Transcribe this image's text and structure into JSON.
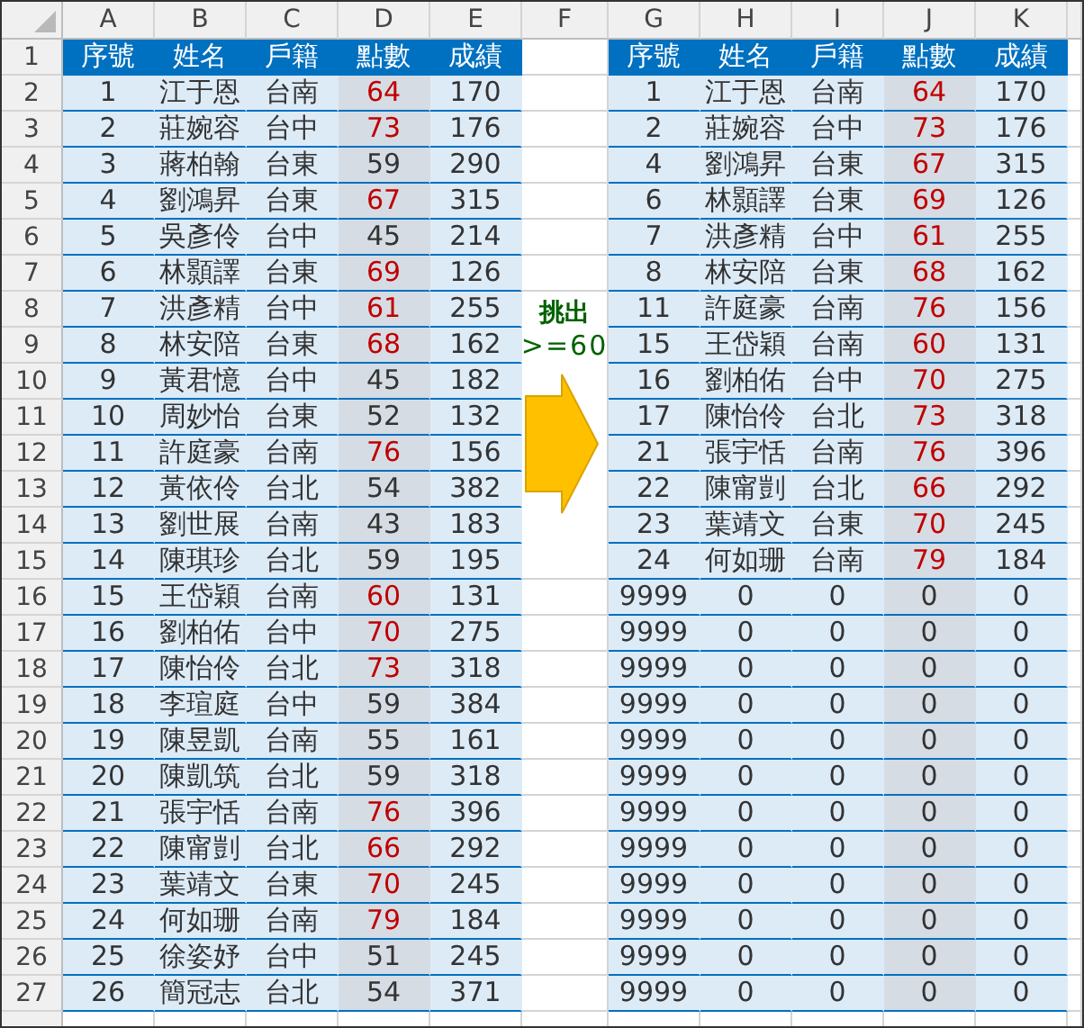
{
  "columns": [
    "A",
    "B",
    "C",
    "D",
    "E",
    "F",
    "G",
    "H",
    "I",
    "J",
    "K"
  ],
  "row_numbers": [
    "1",
    "2",
    "3",
    "4",
    "5",
    "6",
    "7",
    "8",
    "9",
    "10",
    "11",
    "12",
    "13",
    "14",
    "15",
    "16",
    "17",
    "18",
    "19",
    "20",
    "21",
    "22",
    "23",
    "24",
    "25",
    "26",
    "27"
  ],
  "source_table": {
    "headers": [
      "序號",
      "姓名",
      "戶籍",
      "點數",
      "成績"
    ],
    "rows": [
      {
        "no": "1",
        "name": "江于恩",
        "city": "台南",
        "points": "64",
        "score": "170",
        "highlighted": true
      },
      {
        "no": "2",
        "name": "莊婉容",
        "city": "台中",
        "points": "73",
        "score": "176",
        "highlighted": true
      },
      {
        "no": "3",
        "name": "蔣柏翰",
        "city": "台東",
        "points": "59",
        "score": "290",
        "highlighted": false
      },
      {
        "no": "4",
        "name": "劉鴻昇",
        "city": "台東",
        "points": "67",
        "score": "315",
        "highlighted": true
      },
      {
        "no": "5",
        "name": "吳彥伶",
        "city": "台中",
        "points": "45",
        "score": "214",
        "highlighted": false
      },
      {
        "no": "6",
        "name": "林顥譯",
        "city": "台東",
        "points": "69",
        "score": "126",
        "highlighted": true
      },
      {
        "no": "7",
        "name": "洪彥精",
        "city": "台中",
        "points": "61",
        "score": "255",
        "highlighted": true
      },
      {
        "no": "8",
        "name": "林安陪",
        "city": "台東",
        "points": "68",
        "score": "162",
        "highlighted": true
      },
      {
        "no": "9",
        "name": "黃君憶",
        "city": "台中",
        "points": "45",
        "score": "182",
        "highlighted": false
      },
      {
        "no": "10",
        "name": "周妙怡",
        "city": "台東",
        "points": "52",
        "score": "132",
        "highlighted": false
      },
      {
        "no": "11",
        "name": "許庭豪",
        "city": "台南",
        "points": "76",
        "score": "156",
        "highlighted": true
      },
      {
        "no": "12",
        "name": "黃依伶",
        "city": "台北",
        "points": "54",
        "score": "382",
        "highlighted": false
      },
      {
        "no": "13",
        "name": "劉世展",
        "city": "台南",
        "points": "43",
        "score": "183",
        "highlighted": false
      },
      {
        "no": "14",
        "name": "陳琪珍",
        "city": "台北",
        "points": "59",
        "score": "195",
        "highlighted": false
      },
      {
        "no": "15",
        "name": "王岱穎",
        "city": "台南",
        "points": "60",
        "score": "131",
        "highlighted": true
      },
      {
        "no": "16",
        "name": "劉柏佑",
        "city": "台中",
        "points": "70",
        "score": "275",
        "highlighted": true
      },
      {
        "no": "17",
        "name": "陳怡伶",
        "city": "台北",
        "points": "73",
        "score": "318",
        "highlighted": true
      },
      {
        "no": "18",
        "name": "李瑄庭",
        "city": "台中",
        "points": "59",
        "score": "384",
        "highlighted": false
      },
      {
        "no": "19",
        "name": "陳昱凱",
        "city": "台南",
        "points": "55",
        "score": "161",
        "highlighted": false
      },
      {
        "no": "20",
        "name": "陳凱筑",
        "city": "台北",
        "points": "59",
        "score": "318",
        "highlighted": false
      },
      {
        "no": "21",
        "name": "張宇恬",
        "city": "台南",
        "points": "76",
        "score": "396",
        "highlighted": true
      },
      {
        "no": "22",
        "name": "陳甯剴",
        "city": "台北",
        "points": "66",
        "score": "292",
        "highlighted": true
      },
      {
        "no": "23",
        "name": "葉靖文",
        "city": "台東",
        "points": "70",
        "score": "245",
        "highlighted": true
      },
      {
        "no": "24",
        "name": "何如珊",
        "city": "台南",
        "points": "79",
        "score": "184",
        "highlighted": true
      },
      {
        "no": "25",
        "name": "徐姿妤",
        "city": "台中",
        "points": "51",
        "score": "245",
        "highlighted": false
      },
      {
        "no": "26",
        "name": "簡冠志",
        "city": "台北",
        "points": "54",
        "score": "371",
        "highlighted": false
      }
    ]
  },
  "annotation": {
    "label": "挑出",
    "condition": ">=60"
  },
  "result_table": {
    "headers": [
      "序號",
      "姓名",
      "戶籍",
      "點數",
      "成績"
    ],
    "rows": [
      {
        "no": "1",
        "name": "江于恩",
        "city": "台南",
        "points": "64",
        "score": "170",
        "highlighted": true
      },
      {
        "no": "2",
        "name": "莊婉容",
        "city": "台中",
        "points": "73",
        "score": "176",
        "highlighted": true
      },
      {
        "no": "4",
        "name": "劉鴻昇",
        "city": "台東",
        "points": "67",
        "score": "315",
        "highlighted": true
      },
      {
        "no": "6",
        "name": "林顥譯",
        "city": "台東",
        "points": "69",
        "score": "126",
        "highlighted": true
      },
      {
        "no": "7",
        "name": "洪彥精",
        "city": "台中",
        "points": "61",
        "score": "255",
        "highlighted": true
      },
      {
        "no": "8",
        "name": "林安陪",
        "city": "台東",
        "points": "68",
        "score": "162",
        "highlighted": true
      },
      {
        "no": "11",
        "name": "許庭豪",
        "city": "台南",
        "points": "76",
        "score": "156",
        "highlighted": true
      },
      {
        "no": "15",
        "name": "王岱穎",
        "city": "台南",
        "points": "60",
        "score": "131",
        "highlighted": true
      },
      {
        "no": "16",
        "name": "劉柏佑",
        "city": "台中",
        "points": "70",
        "score": "275",
        "highlighted": true
      },
      {
        "no": "17",
        "name": "陳怡伶",
        "city": "台北",
        "points": "73",
        "score": "318",
        "highlighted": true
      },
      {
        "no": "21",
        "name": "張宇恬",
        "city": "台南",
        "points": "76",
        "score": "396",
        "highlighted": true
      },
      {
        "no": "22",
        "name": "陳甯剴",
        "city": "台北",
        "points": "66",
        "score": "292",
        "highlighted": true
      },
      {
        "no": "23",
        "name": "葉靖文",
        "city": "台東",
        "points": "70",
        "score": "245",
        "highlighted": true
      },
      {
        "no": "24",
        "name": "何如珊",
        "city": "台南",
        "points": "79",
        "score": "184",
        "highlighted": true
      },
      {
        "no": "9999",
        "name": "0",
        "city": "0",
        "points": "0",
        "score": "0",
        "highlighted": false
      },
      {
        "no": "9999",
        "name": "0",
        "city": "0",
        "points": "0",
        "score": "0",
        "highlighted": false
      },
      {
        "no": "9999",
        "name": "0",
        "city": "0",
        "points": "0",
        "score": "0",
        "highlighted": false
      },
      {
        "no": "9999",
        "name": "0",
        "city": "0",
        "points": "0",
        "score": "0",
        "highlighted": false
      },
      {
        "no": "9999",
        "name": "0",
        "city": "0",
        "points": "0",
        "score": "0",
        "highlighted": false
      },
      {
        "no": "9999",
        "name": "0",
        "city": "0",
        "points": "0",
        "score": "0",
        "highlighted": false
      },
      {
        "no": "9999",
        "name": "0",
        "city": "0",
        "points": "0",
        "score": "0",
        "highlighted": false
      },
      {
        "no": "9999",
        "name": "0",
        "city": "0",
        "points": "0",
        "score": "0",
        "highlighted": false
      },
      {
        "no": "9999",
        "name": "0",
        "city": "0",
        "points": "0",
        "score": "0",
        "highlighted": false
      },
      {
        "no": "9999",
        "name": "0",
        "city": "0",
        "points": "0",
        "score": "0",
        "highlighted": false
      },
      {
        "no": "9999",
        "name": "0",
        "city": "0",
        "points": "0",
        "score": "0",
        "highlighted": false
      },
      {
        "no": "9999",
        "name": "0",
        "city": "0",
        "points": "0",
        "score": "0",
        "highlighted": false
      }
    ]
  }
}
